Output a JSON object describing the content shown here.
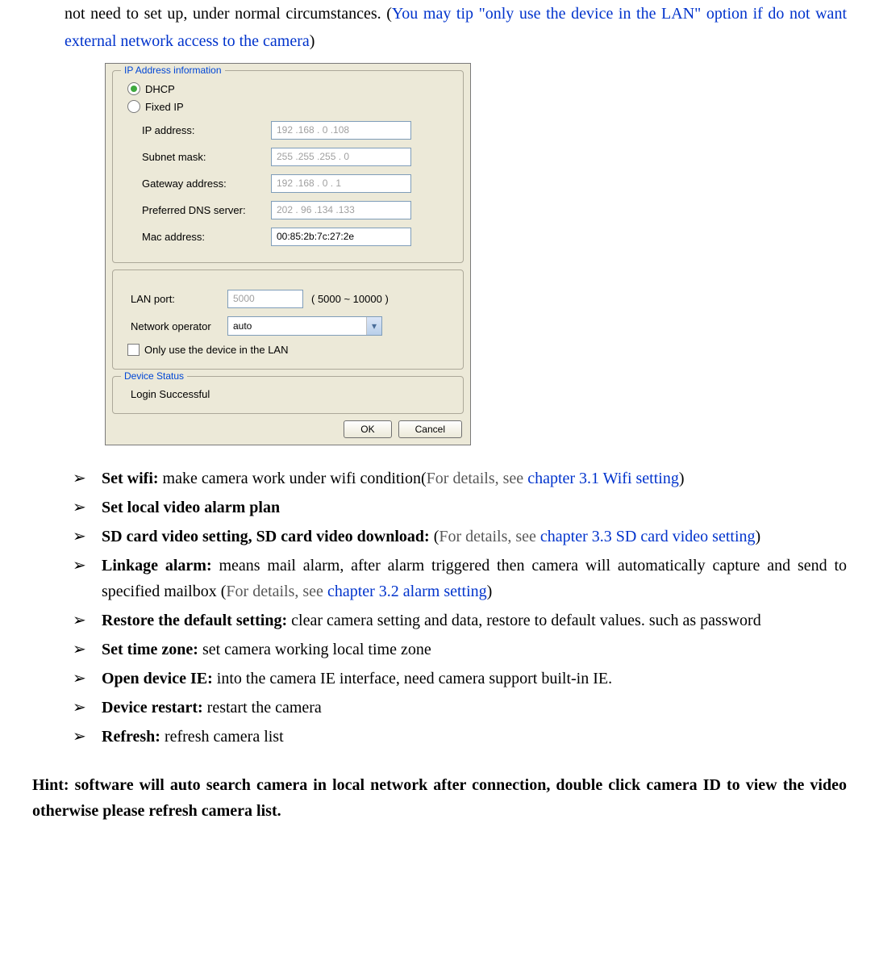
{
  "top": {
    "line1": "not need to set up, under normal circumstances. (",
    "blue": "You may tip \"only use the device in the LAN\" option if do not want external network access to the camera",
    "line1_end": ")"
  },
  "dialog": {
    "group1_title": "IP Address information",
    "radio_dhcp": "DHCP",
    "radio_fixed": "Fixed IP",
    "labels": {
      "ip": "IP address:",
      "mask": "Subnet mask:",
      "gateway": "Gateway address:",
      "dns": "Preferred DNS server:",
      "mac": "Mac address:",
      "lan": "LAN port:",
      "netop": "Network operator",
      "only_lan": "Only use the device in the LAN"
    },
    "values": {
      "ip": "192 .168 . 0  .108",
      "mask": "255 .255 .255 . 0",
      "gateway": "192 .168 . 0  . 1",
      "dns": "202 . 96 .134 .133",
      "mac": "00:85:2b:7c:27:2e",
      "lan": "5000",
      "lan_hint": "( 5000 ~ 10000 )",
      "netop": "auto"
    },
    "group2_title": "Device Status",
    "status_text": "Login Successful",
    "ok": "OK",
    "cancel": "Cancel"
  },
  "list": [
    {
      "bold": "Set wifi:",
      "text": " make camera work under wifi condition(",
      "gray": "For details, see ",
      "link": "chapter 3.1 Wifi setting",
      "tail": ")"
    },
    {
      "bold": "Set local video alarm plan",
      "text": "",
      "gray": "",
      "link": "",
      "tail": ""
    },
    {
      "bold": "SD card video setting, SD card video download:",
      "text": " (",
      "gray": "For details, see ",
      "link": "chapter 3.3 SD card video setting",
      "tail": ")"
    },
    {
      "bold": "Linkage alarm:",
      "text": " means mail alarm, after alarm triggered then camera will automatically capture and send to specified mailbox (",
      "gray": "For details, see ",
      "link": "chapter 3.2 alarm setting",
      "tail": ")"
    },
    {
      "bold": "Restore the default setting:",
      "text": " clear camera setting and data, restore to default values. such as password",
      "gray": "",
      "link": "",
      "tail": ""
    },
    {
      "bold": "Set time zone:",
      "text": " set camera working local time zone",
      "gray": "",
      "link": "",
      "tail": ""
    },
    {
      "bold": "Open device IE:",
      "text": " into the camera IE interface, need camera support built-in IE.",
      "gray": "",
      "link": "",
      "tail": ""
    },
    {
      "bold": "Device restart:",
      "text": " restart the camera",
      "gray": "",
      "link": "",
      "tail": ""
    },
    {
      "bold": "Refresh:",
      "text": " refresh camera list",
      "gray": "",
      "link": "",
      "tail": ""
    }
  ],
  "hint": "Hint: software will auto search camera in local network after connection, double click camera ID to view the video otherwise please refresh camera list."
}
